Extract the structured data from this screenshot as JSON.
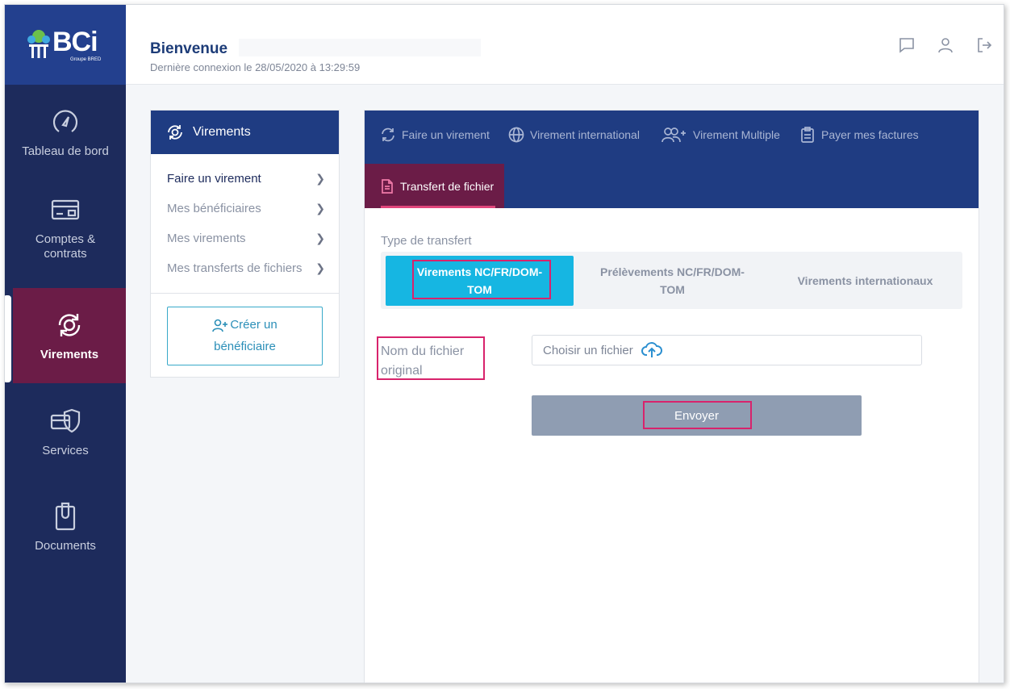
{
  "brand": {
    "logo_text": "BCi",
    "logo_sub": "Groupe BRED"
  },
  "sidebar": {
    "items": [
      {
        "label": "Tableau de bord",
        "icon": "dashboard-gauge-icon"
      },
      {
        "label": "Comptes & contrats",
        "icon": "card-icon"
      },
      {
        "label": "Virements",
        "icon": "transfer-cycle-icon",
        "active": true
      },
      {
        "label": "Services",
        "icon": "shield-card-icon"
      },
      {
        "label": "Documents",
        "icon": "clipboard-icon"
      }
    ]
  },
  "header": {
    "title": "Bienvenue",
    "last_login": "Dernière connexion le 28/05/2020 à 13:29:59",
    "icons": [
      "message-icon",
      "user-icon",
      "logout-icon"
    ]
  },
  "submenu": {
    "title": "Virements",
    "items": [
      {
        "label": "Faire un virement",
        "current": true
      },
      {
        "label": "Mes bénéficiaires"
      },
      {
        "label": "Mes virements"
      },
      {
        "label": "Mes transferts de fichiers"
      }
    ],
    "create_label_line1": "Créer un",
    "create_label_line2": "bénéficiaire"
  },
  "tabs": {
    "items": [
      {
        "label": "Faire un virement",
        "icon": "refresh-icon"
      },
      {
        "label": "Virement international",
        "icon": "globe-icon"
      },
      {
        "label": "Virement Multiple",
        "icon": "users-plus-icon"
      },
      {
        "label": "Payer mes factures",
        "icon": "clipboard-list-icon"
      }
    ],
    "active": {
      "label": "Transfert de fichier",
      "icon": "file-doc-icon"
    }
  },
  "form": {
    "type_label": "Type de transfert",
    "types": [
      {
        "line1": "Virements NC/FR/DOM-",
        "line2": "TOM",
        "active": true
      },
      {
        "line1": "Prélèvements NC/FR/DOM-",
        "line2": "TOM"
      },
      {
        "line1": "Virements internationaux",
        "line2": ""
      }
    ],
    "file_label_line1": "Nom du fichier",
    "file_label_line2": "original",
    "file_placeholder": "Choisir un fichier",
    "submit_label": "Envoyer"
  },
  "colors": {
    "sidebar": "#1d2b5c",
    "active_nav": "#6b1c47",
    "header_blue": "#1f3c82",
    "accent_cyan": "#16b6e2",
    "highlight": "#d8236c"
  }
}
